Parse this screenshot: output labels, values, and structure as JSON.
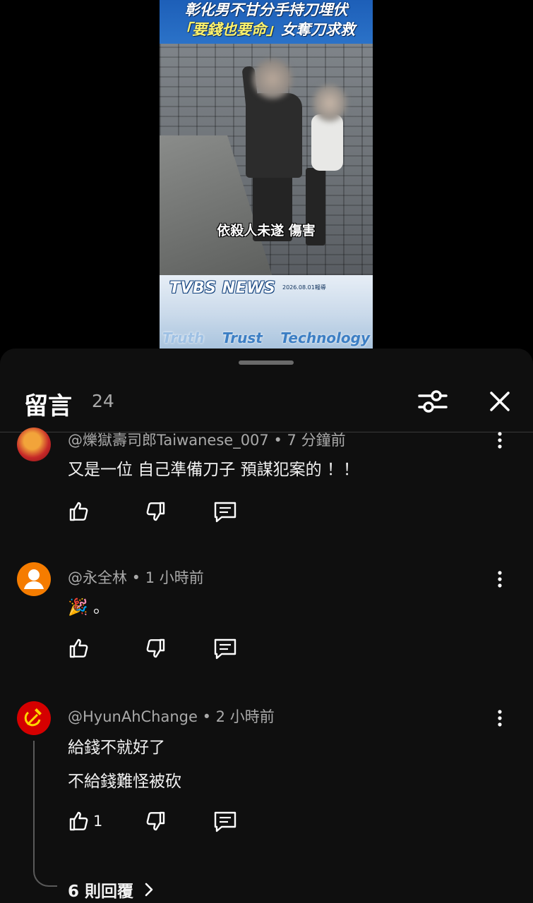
{
  "video": {
    "headline_line1": "彰化男不甘分手持刀埋伏",
    "headline_line2_part1": "「要錢也要命」",
    "headline_line2_part2": "女奪刀求救",
    "subtitle": "依殺人未遂 傷害",
    "news_logo": "TVBS NEWS",
    "news_date": "2026.08.01報導",
    "tags": [
      "Truth",
      "Trust",
      "Technology"
    ]
  },
  "comments_panel": {
    "title": "留言",
    "count": "24",
    "filter_icon": "sliders-icon",
    "close_icon": "close-icon"
  },
  "comments": [
    {
      "author": "@爍獄壽司郎Taiwanese_007",
      "time": "7 分鐘前",
      "lines": [
        "又是一位 自己準備刀子 預謀犯案的 ！！"
      ],
      "likes": "",
      "avatar_color": "#c62828"
    },
    {
      "author": "@永全林",
      "time": "1 小時前",
      "lines": [
        "。"
      ],
      "emoji": "🎉",
      "likes": "",
      "avatar_color": "#f57c00"
    },
    {
      "author": "@HyunAhChange",
      "time": "2 小時前",
      "lines": [
        "給錢不就好了",
        "不給錢難怪被砍"
      ],
      "likes": "1",
      "avatar_color": "#d50000",
      "replies_label": "6 則回覆"
    }
  ],
  "colors": {
    "sheet_bg": "#0f0f0f",
    "text_primary": "#f1f1f1",
    "text_secondary": "#aaaaaa"
  }
}
